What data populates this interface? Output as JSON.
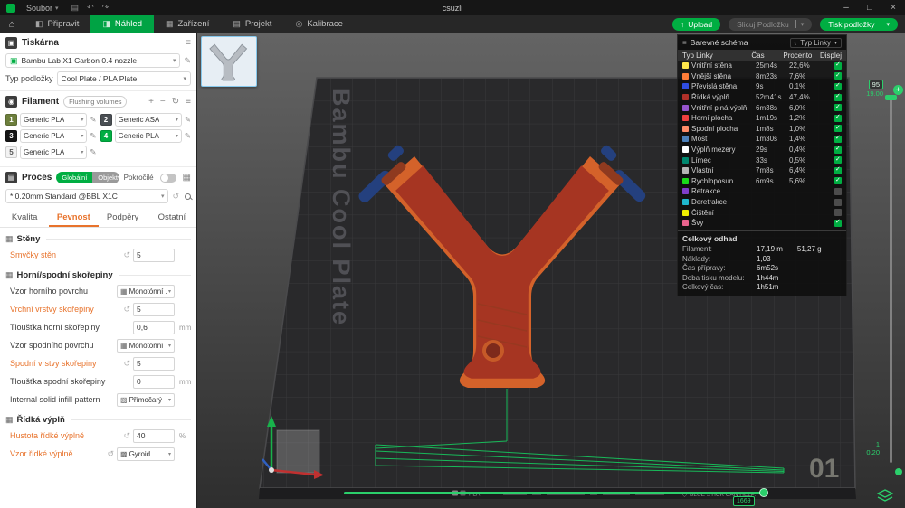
{
  "icons": {
    "caret_down": "▾",
    "pencil": "✎",
    "revert": "↺",
    "plus": "+",
    "minus": "−",
    "refresh": "↻",
    "menu": "≡",
    "home": "⌂",
    "upload_arrow": "↑",
    "window_min": "–",
    "window_max": "□",
    "window_close": "×",
    "save": "▤",
    "undo": "↶",
    "redo": "↷",
    "grid": "▦",
    "chevron_left": "‹",
    "diamond": "◇",
    "printer": "▣",
    "filament": "◉",
    "process": "▤",
    "nozzle": "▣"
  },
  "titlebar": {
    "file_menu": "Soubor",
    "title": "csuzli"
  },
  "menubar": {
    "tabs": [
      {
        "label": "Připravit",
        "icon": "◧",
        "active": false
      },
      {
        "label": "Náhled",
        "icon": "◨",
        "active": true
      },
      {
        "label": "Zařízení",
        "icon": "▦",
        "active": false
      },
      {
        "label": "Projekt",
        "icon": "▤",
        "active": false
      },
      {
        "label": "Kalibrace",
        "icon": "◎",
        "active": false
      }
    ],
    "upload_label": "Upload",
    "slice_label": "Slicuj Podložku",
    "print_label": "Tisk podložky"
  },
  "sidebar": {
    "printer_section": "Tiskárna",
    "printer_name": "Bambu Lab X1 Carbon 0.4 nozzle",
    "plate_type_label": "Typ podložky",
    "plate_type_value": "Cool Plate / PLA Plate",
    "filament_section": "Filament",
    "flushing_volumes": "Flushing volumes",
    "filaments": [
      {
        "num": "1",
        "name": "Generic PLA",
        "chip": "#6d7f3c",
        "fg": "#ffffff"
      },
      {
        "num": "2",
        "name": "Generic ASA",
        "chip": "#4a4f54",
        "fg": "#ffffff"
      },
      {
        "num": "3",
        "name": "Generic PLA",
        "chip": "#151515",
        "fg": "#ffffff"
      },
      {
        "num": "4",
        "name": "Generic PLA",
        "chip": "#00ae42",
        "fg": "#ffffff"
      },
      {
        "num": "5",
        "name": "Generic PLA",
        "chip": "#f2f2f2",
        "fg": "#555555"
      }
    ],
    "process_section": "Proces",
    "toggle_global": "Globální",
    "toggle_objects": "Objekty",
    "advanced_label": "Pokročilé",
    "preset": "* 0.20mm Standard @BBL X1C",
    "tabs": [
      {
        "label": "Kvalita",
        "active": false
      },
      {
        "label": "Pevnost",
        "active": true
      },
      {
        "label": "Podpěry",
        "active": false
      },
      {
        "label": "Ostatní",
        "active": false
      }
    ],
    "groups": {
      "walls": "Stěny",
      "shells": "Horní/spodní skořepiny",
      "infill": "Řídká výplň"
    },
    "params": {
      "wall_loops": {
        "label": "Smyčky stěn",
        "value": "5"
      },
      "top_pattern": {
        "label": "Vzor horního povrchu",
        "value": "Monotónní ..",
        "icon": "▦"
      },
      "top_layers": {
        "label": "Vrchní vrstvy skořepiny",
        "value": "5"
      },
      "top_thickness": {
        "label": "Tloušťka horní skořepiny",
        "value": "0,6",
        "unit": "mm"
      },
      "bottom_pattern": {
        "label": "Vzor spodního povrchu",
        "value": "Monotónní",
        "icon": "▦"
      },
      "bottom_layers": {
        "label": "Spodní vrstvy skořepiny",
        "value": "5"
      },
      "bottom_thickness": {
        "label": "Tloušťka spodní skořepiny",
        "value": "0",
        "unit": "mm"
      },
      "internal_solid_pattern": {
        "label": "Internal solid infill pattern",
        "value": "Přímočarý",
        "icon": "▨"
      },
      "infill_density": {
        "label": "Hustota řídké výplně",
        "value": "40",
        "unit": "%"
      },
      "infill_pattern": {
        "label": "Vzor řídké výplně",
        "value": "Gyroid",
        "icon": "▩"
      }
    }
  },
  "viewport": {
    "plate_name": "Bambu Cool Plate",
    "plate_number": "01",
    "plate_material": "PLA",
    "plate_hint": "BLUE STICK CAN HELP."
  },
  "legend": {
    "title": "Barevné schéma",
    "mode": "Typ Linky",
    "columns": {
      "type": "Typ Linky",
      "time": "Čas",
      "percent": "Procento",
      "display": "Displej"
    },
    "rows": [
      {
        "label": "Vnitřní stěna",
        "time": "25m4s",
        "pct": "22,6%",
        "color": "#fde64b",
        "checked": true
      },
      {
        "label": "Vnější stěna",
        "time": "8m23s",
        "pct": "7,6%",
        "color": "#ff7d38",
        "checked": true
      },
      {
        "label": "Převislá stěna",
        "time": "9s",
        "pct": "0,1%",
        "color": "#2f4de0",
        "checked": true
      },
      {
        "label": "Řídká výplň",
        "time": "52m41s",
        "pct": "47,4%",
        "color": "#b03029",
        "checked": true
      },
      {
        "label": "Vnitřní plná výplň",
        "time": "6m38s",
        "pct": "6,0%",
        "color": "#9654cc",
        "checked": true
      },
      {
        "label": "Horní plocha",
        "time": "1m19s",
        "pct": "1,2%",
        "color": "#f04040",
        "checked": true
      },
      {
        "label": "Spodní plocha",
        "time": "1m8s",
        "pct": "1,0%",
        "color": "#ff8c69",
        "checked": true
      },
      {
        "label": "Most",
        "time": "1m30s",
        "pct": "1,4%",
        "color": "#4c80ba",
        "checked": true
      },
      {
        "label": "Výplň mezery",
        "time": "29s",
        "pct": "0,4%",
        "color": "#ffffff",
        "checked": true
      },
      {
        "label": "Límec",
        "time": "33s",
        "pct": "0,5%",
        "color": "#00876e",
        "checked": true
      },
      {
        "label": "Vlastní",
        "time": "7m8s",
        "pct": "6,4%",
        "color": "#b5b5b5",
        "checked": true
      },
      {
        "label": "Rychloposun",
        "time": "6m9s",
        "pct": "5,6%",
        "color": "#1adb1a",
        "checked": true
      },
      {
        "label": "Retrakce",
        "time": "",
        "pct": "",
        "color": "#803eca",
        "checked": false
      },
      {
        "label": "Deretrakce",
        "time": "",
        "pct": "",
        "color": "#1fb7ce",
        "checked": false
      },
      {
        "label": "Čištění",
        "time": "",
        "pct": "",
        "color": "#eded00",
        "checked": false
      },
      {
        "label": "Švy",
        "time": "",
        "pct": "",
        "color": "#e9638d",
        "checked": true
      }
    ],
    "summary_title": "Celkový odhad",
    "summary": [
      {
        "label": "Filament:",
        "value": "17,19 m",
        "value2": "51,27 g"
      },
      {
        "label": "Náklady:",
        "value": "1,03"
      },
      {
        "label": "Čas přípravy:",
        "value": "6m52s"
      },
      {
        "label": "Doba tisku modelu:",
        "value": "1h44m"
      },
      {
        "label": "Celkový čas:",
        "value": "1h51m"
      }
    ]
  },
  "sliders": {
    "layer_max": "95",
    "layer_max_height": "19.00",
    "layer_min": "1",
    "layer_min_height": "0.20",
    "move_value": "1669"
  },
  "colors": {
    "accent_green": "#00ae42",
    "modified_orange": "#e8732c",
    "model_orange": "#d4622a",
    "model_red": "#a63522",
    "support_blue": "#24407e"
  }
}
